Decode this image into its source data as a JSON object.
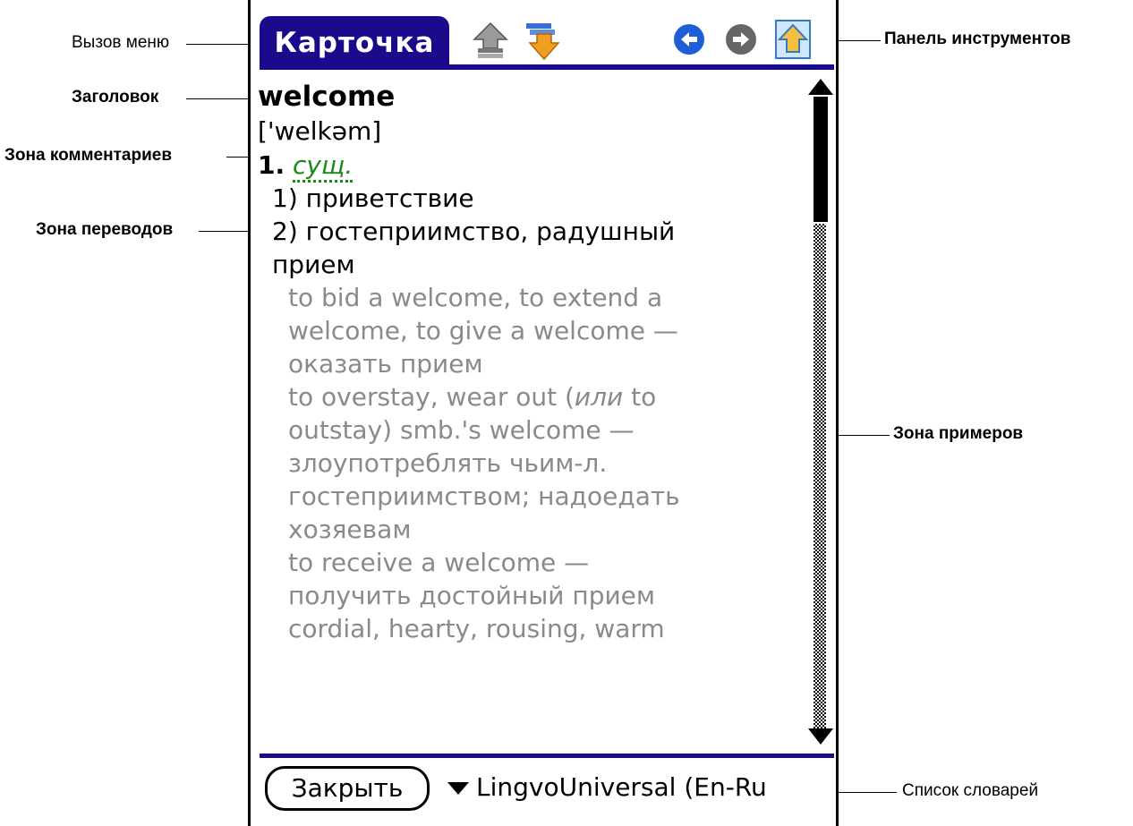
{
  "callouts": {
    "menu_call": "Вызов меню",
    "header": "Заголовок",
    "comments_zone": "Зона комментариев",
    "translations_zone": "Зона переводов",
    "toolbar": "Панель инструментов",
    "examples_zone": "Зона примеров",
    "dict_list": "Список словарей"
  },
  "app": {
    "menu_title": "Карточка",
    "toolbar_icons": [
      "upload-icon",
      "download-icon",
      "back-icon",
      "forward-icon",
      "home-icon"
    ]
  },
  "entry": {
    "headword": "welcome",
    "transcription": "['welkəm]",
    "sense_number": "1.",
    "part_of_speech": "сущ.",
    "translations": [
      "1) приветствие",
      "2) гостеприимство, радушный",
      "прием"
    ],
    "examples": [
      "to bid a welcome, to extend a",
      "welcome, to give a welcome —",
      "оказать прием",
      "to overstay, wear out (",
      "или",
      " to",
      "outstay) smb.'s welcome —",
      "злоупотреблять чьим-л.",
      "гостеприимством; надоедать",
      "хозяевам",
      "to receive a welcome —",
      "получить достойный прием",
      "cordial, hearty, rousing, warm"
    ]
  },
  "bottom": {
    "close_label": "Закрыть",
    "dictionary": "LingvoUniversal (En-Ru"
  },
  "colors": {
    "accent": "#1b0a8c",
    "pos_green": "#1a8a1a",
    "example_gray": "#8a8a8a"
  }
}
